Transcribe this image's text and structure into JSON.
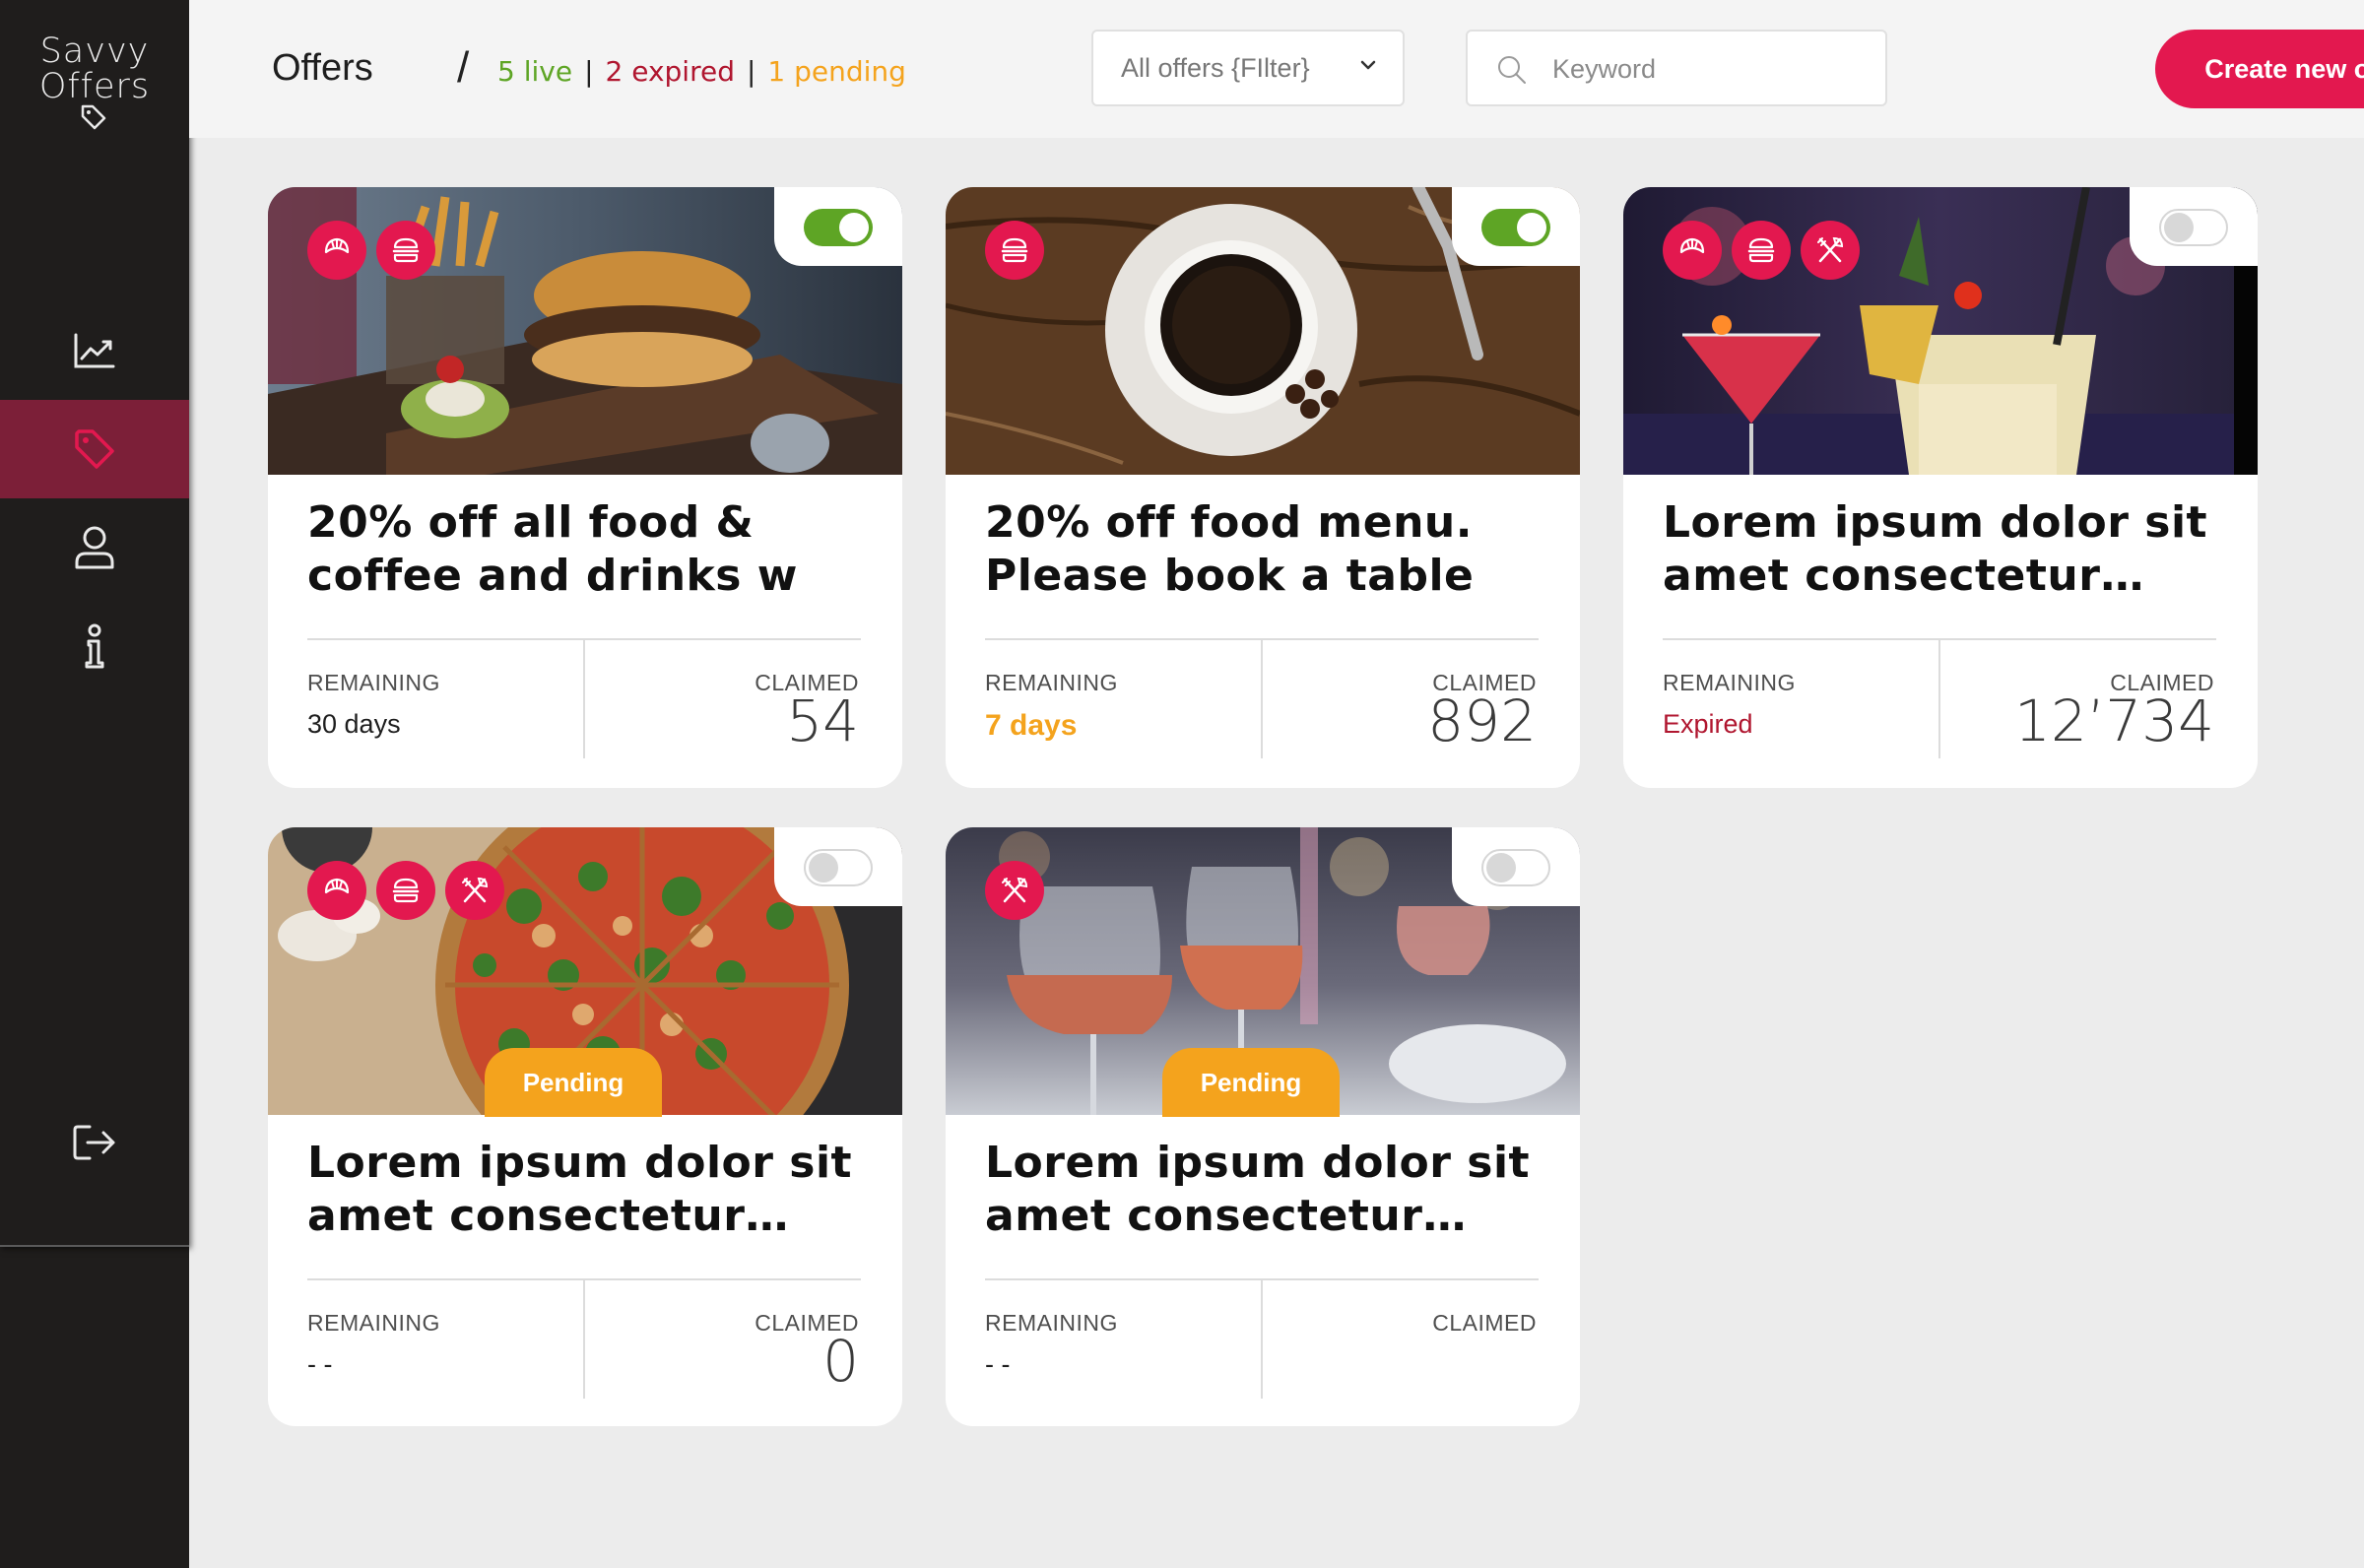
{
  "brand": {
    "line1": "Savvy",
    "line2": "Offers"
  },
  "header": {
    "title": "Offers",
    "separator": "/",
    "live": "5 live",
    "expired": "2 expired",
    "pending": "1 pending",
    "divider": "|",
    "filter_label": "All offers {FIlter}",
    "search_placeholder": "Keyword",
    "create_label": "Create new offer"
  },
  "nav": {
    "items": [
      {
        "name": "analytics",
        "icon": "chart-line-icon",
        "active": false
      },
      {
        "name": "offers",
        "icon": "tag-icon",
        "active": true
      },
      {
        "name": "profile",
        "icon": "user-icon",
        "active": false
      },
      {
        "name": "info",
        "icon": "info-icon",
        "active": false
      },
      {
        "name": "logout",
        "icon": "logout-icon",
        "active": false
      }
    ]
  },
  "labels": {
    "remaining": "REMAINING",
    "claimed": "CLAIMED"
  },
  "cards": [
    {
      "title_line1": "20% off all food &",
      "title_line2": "coffee and drinks w",
      "remaining": "30 days",
      "claimed": "54",
      "active": true,
      "categories": [
        "croissant-icon",
        "burger-icon"
      ],
      "pending": ""
    },
    {
      "title_line1": "20% off food menu.",
      "title_line2": "Please book a table",
      "remaining": "7 days",
      "claimed": "892",
      "active": true,
      "categories": [
        "burger-icon"
      ],
      "pending": ""
    },
    {
      "title_line1": "Lorem ipsum dolor sit",
      "title_line2": "amet consectetur…",
      "remaining": "Expired",
      "claimed": "12’734",
      "active": false,
      "categories": [
        "croissant-icon",
        "burger-icon",
        "cutlery-icon"
      ],
      "pending": ""
    },
    {
      "title_line1": "Lorem ipsum dolor sit",
      "title_line2": "amet consectetur…",
      "remaining": "- -",
      "claimed": "0",
      "active": false,
      "categories": [
        "croissant-icon",
        "burger-icon",
        "cutlery-icon"
      ],
      "pending": "Pending"
    },
    {
      "title_line1": "Lorem ipsum dolor sit",
      "title_line2": "amet consectetur…",
      "remaining": "- -",
      "claimed": "",
      "active": false,
      "categories": [
        "cutlery-icon"
      ],
      "pending": "Pending"
    }
  ],
  "colors": {
    "accent": "#e3184f",
    "sidebar": "#1f1d1c",
    "sidebar_active": "#7c1f38",
    "live": "#5ea525",
    "expired": "#b0162f",
    "pending": "#f4a31d"
  }
}
